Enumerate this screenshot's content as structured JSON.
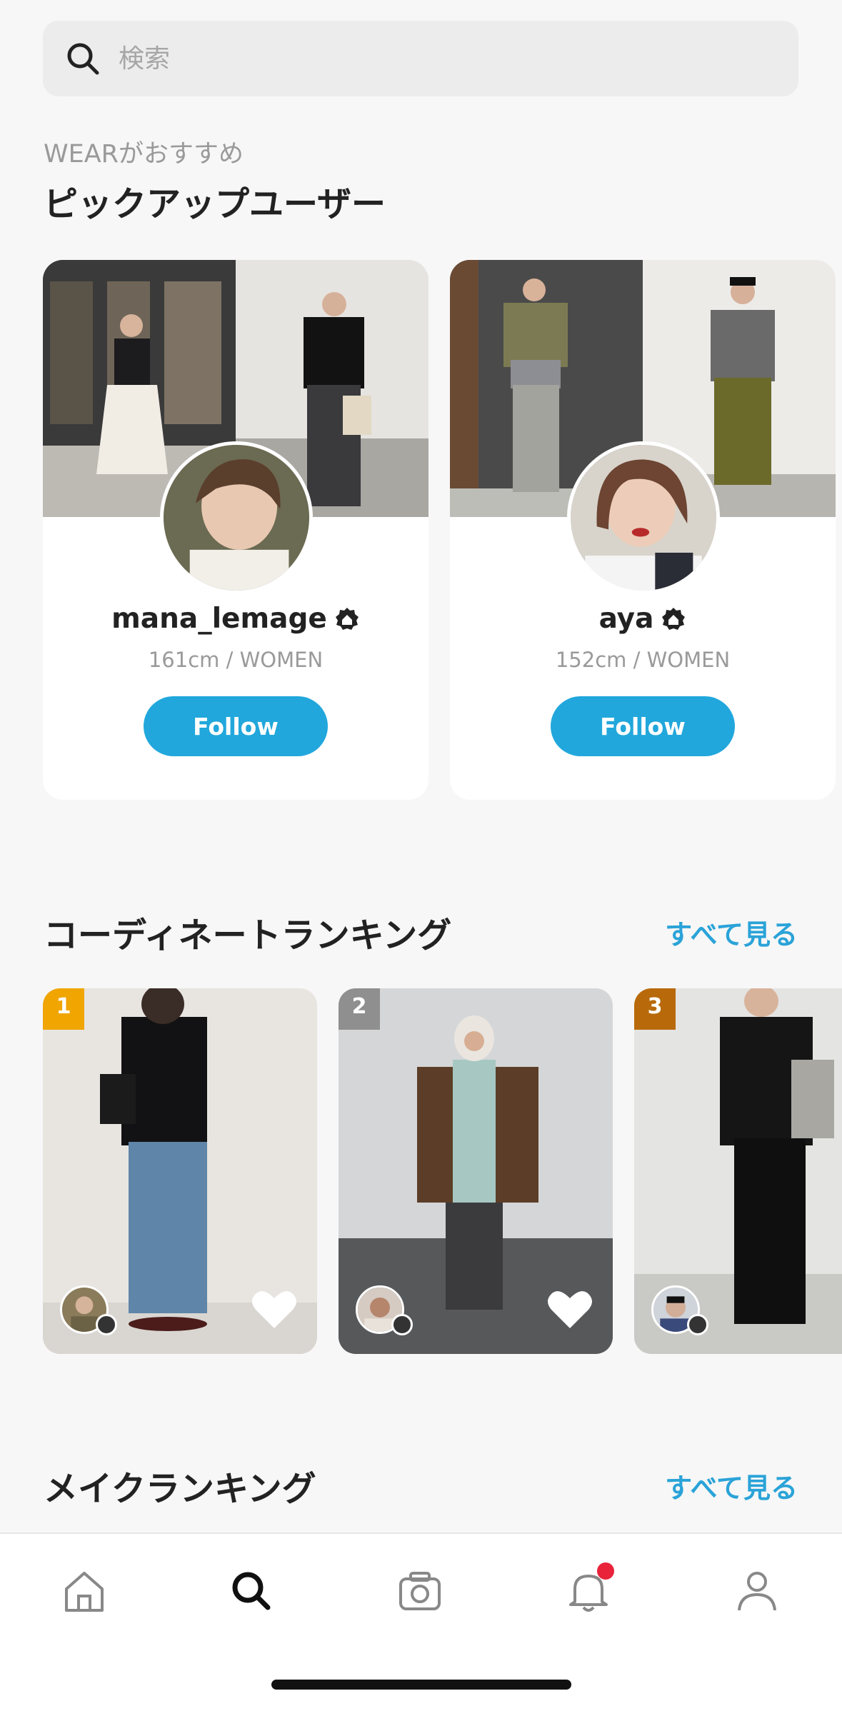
{
  "search": {
    "placeholder": "検索"
  },
  "pickup": {
    "subheading": "WEARがおすすめ",
    "title": "ピックアップユーザー",
    "users": [
      {
        "name": "mana_lemage",
        "meta": "161cm / WOMEN",
        "follow_label": "Follow"
      },
      {
        "name": "aya",
        "meta": "152cm / WOMEN",
        "follow_label": "Follow"
      }
    ]
  },
  "coordinate_ranking": {
    "title": "コーディネートランキング",
    "see_all": "すべて見る",
    "items": [
      {
        "rank": "1",
        "rank_color": "#f0a500"
      },
      {
        "rank": "2",
        "rank_color": "#8f8f8f"
      },
      {
        "rank": "3",
        "rank_color": "#b86a0b"
      }
    ]
  },
  "make_ranking": {
    "title": "メイクランキング",
    "see_all": "すべて見る"
  },
  "nav": {
    "items": [
      {
        "icon": "home-icon"
      },
      {
        "icon": "search-icon",
        "active": true
      },
      {
        "icon": "camera-icon"
      },
      {
        "icon": "bell-icon",
        "badge": true
      },
      {
        "icon": "profile-icon"
      }
    ]
  },
  "colors": {
    "accent": "#21a7dc",
    "notification": "#e8233a"
  }
}
